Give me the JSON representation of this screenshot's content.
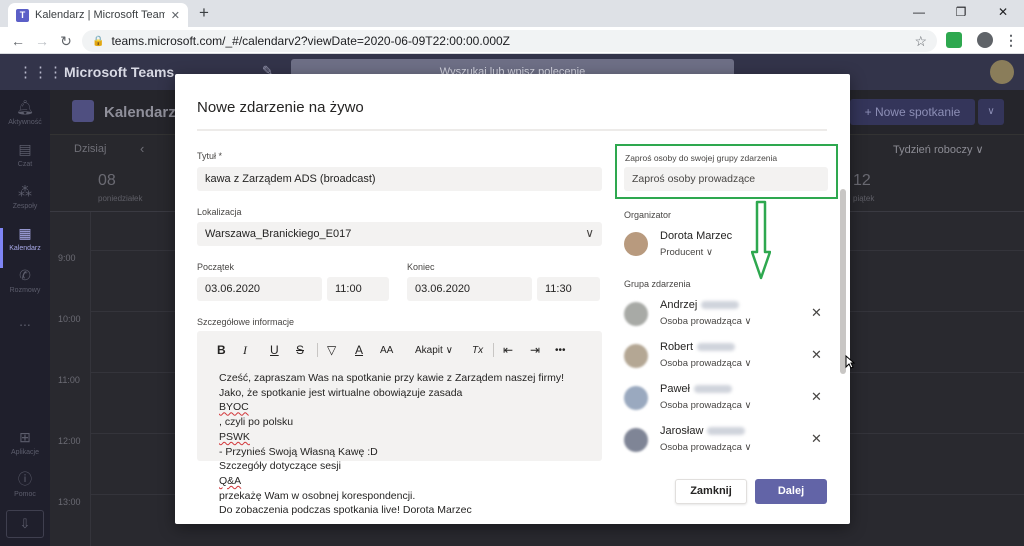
{
  "browser": {
    "tab_title": "Kalendarz | Microsoft Teams",
    "url": "teams.microsoft.com/_#/calendarv2?viewDate=2020-06-09T22:00:00.000Z",
    "tab_close": "✕",
    "new_tab": "+"
  },
  "teams": {
    "app_name": "Microsoft Teams",
    "search_placeholder": "Wyszukaj lub wpisz polecenie"
  },
  "rail": [
    {
      "label": "Aktywność",
      "icon": "bell-icon"
    },
    {
      "label": "Czat",
      "icon": "chat-icon"
    },
    {
      "label": "Zespoły",
      "icon": "teams-icon"
    },
    {
      "label": "Kalendarz",
      "icon": "calendar-icon",
      "active": true
    },
    {
      "label": "Rozmowy",
      "icon": "phone-icon"
    },
    {
      "label": "...",
      "icon": "more-icon"
    },
    {
      "label": "Aplikacje",
      "icon": "apps-icon"
    },
    {
      "label": "Pomoc",
      "icon": "help-icon"
    }
  ],
  "calendar_bg": {
    "title": "Kalendarz",
    "new_meeting": "Nowe spotkanie",
    "today": "Dzisiaj",
    "view": "Tydzień roboczy",
    "day1_num": "08",
    "day1_name": "poniedziałek",
    "day5_num": "12",
    "day5_name": "piątek",
    "times": [
      "9:00",
      "10:00",
      "11:00",
      "12:00",
      "13:00"
    ]
  },
  "modal": {
    "title": "Nowe zdarzenie na żywo",
    "title_field": {
      "label": "Tytuł *",
      "value": "kawa z Zarządem ADS (broadcast)"
    },
    "location": {
      "label": "Lokalizacja",
      "value": "Warszawa_Branickiego_E017"
    },
    "start": {
      "label": "Początek",
      "date": "03.06.2020",
      "time": "11:00"
    },
    "end": {
      "label": "Koniec",
      "date": "03.06.2020",
      "time": "11:30"
    },
    "details": {
      "label": "Szczegółowe informacje",
      "toolbar": {
        "bold": "B",
        "italic": "I",
        "underline": "U",
        "strike": "S",
        "font_color": "A",
        "font_size": "AA",
        "paragraph": "Akapit",
        "clear": "Tx",
        "more": "•••"
      },
      "lines": [
        "Cześć, zapraszam Was na spotkanie przy kawie z Zarządem naszej firmy!",
        "Jako, że spotkanie jest wirtualne obowiązuje zasada BYOC, czyli po polsku PSWK",
        "- Przynieś Swoją Własną Kawę :D",
        "Szczegóły dotyczące sesji Q&A przekażę Wam w osobnej korespondencji.",
        "Do zobaczenia podczas spotkania live! Dorota Marzec"
      ]
    },
    "invite": {
      "label": "Zaproś osoby do swojej grupy zdarzenia",
      "placeholder": "Zaproś osoby prowadzące"
    },
    "organizer": {
      "label": "Organizator",
      "name": "Dorota Marzec",
      "role": "Producent"
    },
    "group": {
      "label": "Grupa zdarzenia",
      "members": [
        {
          "name": "Andrzej",
          "role": "Osoba prowadząca"
        },
        {
          "name": "Robert",
          "role": "Osoba prowadząca"
        },
        {
          "name": "Paweł",
          "role": "Osoba prowadząca"
        },
        {
          "name": "Jarosław",
          "role": "Osoba prowadząca"
        }
      ]
    },
    "close_button": "Zamknij",
    "next_button": "Dalej"
  },
  "colors": {
    "accent": "#6264a7",
    "highlight": "#2ea84f",
    "teams_header": "#33344a"
  }
}
